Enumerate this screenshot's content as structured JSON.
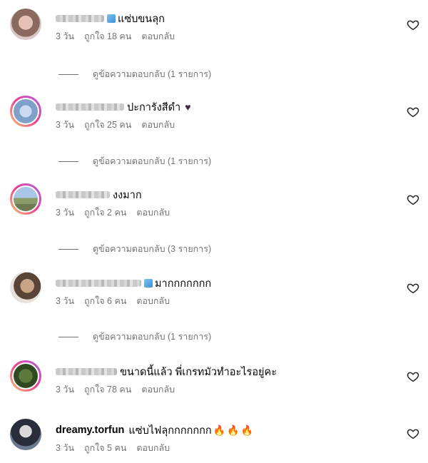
{
  "comments": [
    {
      "text": "แซ่บขนลุก",
      "time": "3 วัน",
      "likes": "ถูกใจ 18 คน",
      "reply": "ตอบกลับ",
      "view_replies": "ดูข้อความตอบกลับ (1 รายการ)"
    },
    {
      "text": "ปะการังสีดำ",
      "time": "3 วัน",
      "likes": "ถูกใจ 25 คน",
      "reply": "ตอบกลับ",
      "view_replies": "ดูข้อความตอบกลับ (1 รายการ)"
    },
    {
      "text": "งงมาก",
      "time": "3 วัน",
      "likes": "ถูกใจ 2 คน",
      "reply": "ตอบกลับ",
      "view_replies": "ดูข้อความตอบกลับ (3 รายการ)"
    },
    {
      "text": "มากกกกกกก",
      "time": "3 วัน",
      "likes": "ถูกใจ 6 คน",
      "reply": "ตอบกลับ",
      "view_replies": "ดูข้อความตอบกลับ (1 รายการ)"
    },
    {
      "text": "ขนาดนี้แล้ว พี่เกรทมัวทำอะไรอยู่คะ",
      "time": "3 วัน",
      "likes": "ถูกใจ 78 คน",
      "reply": "ตอบกลับ"
    },
    {
      "username": "dreamy.torfun",
      "text": "แซ่บไฟลุกกกกกกก",
      "time": "3 วัน",
      "likes": "ถูกใจ 5 คน",
      "reply": "ตอบกลับ"
    }
  ],
  "icons": {
    "like": "heart-outline-icon",
    "dark_heart": "black-heart-emoji",
    "fire": "fire-emoji"
  }
}
